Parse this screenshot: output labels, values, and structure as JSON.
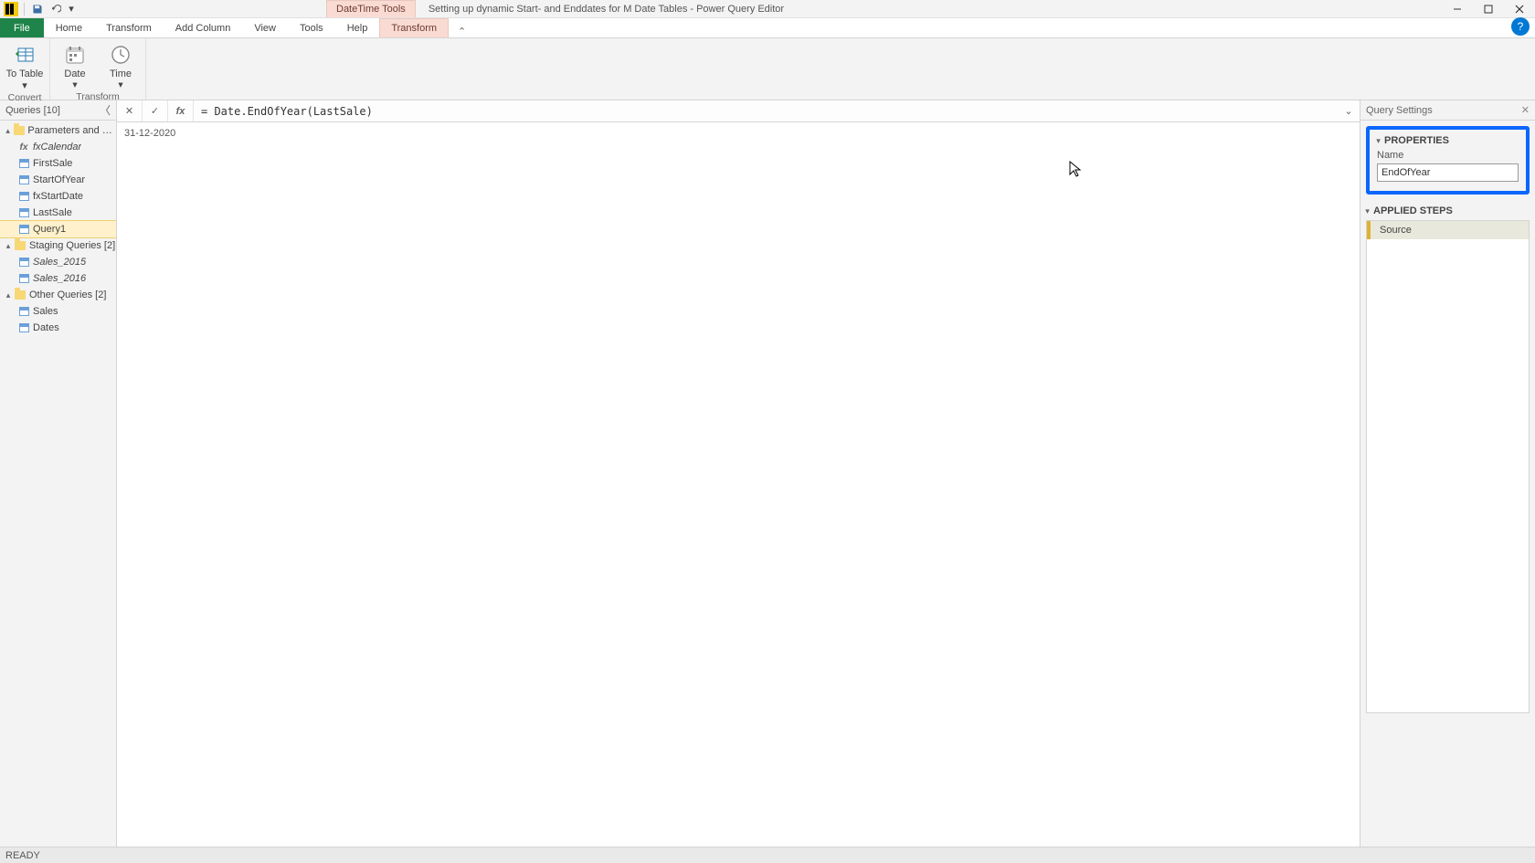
{
  "titlebar": {
    "context_tab": "DateTime Tools",
    "title": "Setting up dynamic Start- and Enddates for M Date Tables - Power Query Editor"
  },
  "tabs": {
    "file": "File",
    "home": "Home",
    "transform": "Transform",
    "add_column": "Add Column",
    "view": "View",
    "tools": "Tools",
    "help": "Help",
    "context_transform": "Transform"
  },
  "ribbon": {
    "to_table": "To Table",
    "to_table_sub": "▾",
    "date": "Date",
    "time": "Time",
    "group_convert": "Convert",
    "group_transform": "Transform"
  },
  "queries": {
    "header": "Queries [10]",
    "groups": [
      {
        "label": "Parameters and Fu...",
        "items": [
          {
            "label": "fxCalendar",
            "iconType": "fx",
            "italic": true
          },
          {
            "label": "FirstSale",
            "iconType": "table"
          },
          {
            "label": "StartOfYear",
            "iconType": "table"
          },
          {
            "label": "fxStartDate",
            "iconType": "table"
          },
          {
            "label": "LastSale",
            "iconType": "table"
          },
          {
            "label": "Query1",
            "iconType": "table",
            "selected": true
          }
        ]
      },
      {
        "label": "Staging Queries [2]",
        "items": [
          {
            "label": "Sales_2015",
            "iconType": "table",
            "italic": true
          },
          {
            "label": "Sales_2016",
            "iconType": "table",
            "italic": true
          }
        ]
      },
      {
        "label": "Other Queries [2]",
        "items": [
          {
            "label": "Sales",
            "iconType": "table"
          },
          {
            "label": "Dates",
            "iconType": "table"
          }
        ]
      }
    ]
  },
  "formula_bar": {
    "value": "= Date.EndOfYear(LastSale)"
  },
  "preview": {
    "value": "31-12-2020"
  },
  "settings": {
    "header": "Query Settings",
    "properties_title": "PROPERTIES",
    "name_label": "Name",
    "name_value": "EndOfYear",
    "applied_steps_title": "APPLIED STEPS",
    "steps": [
      {
        "label": "Source",
        "selected": true
      }
    ]
  },
  "statusbar": {
    "text": "READY"
  }
}
